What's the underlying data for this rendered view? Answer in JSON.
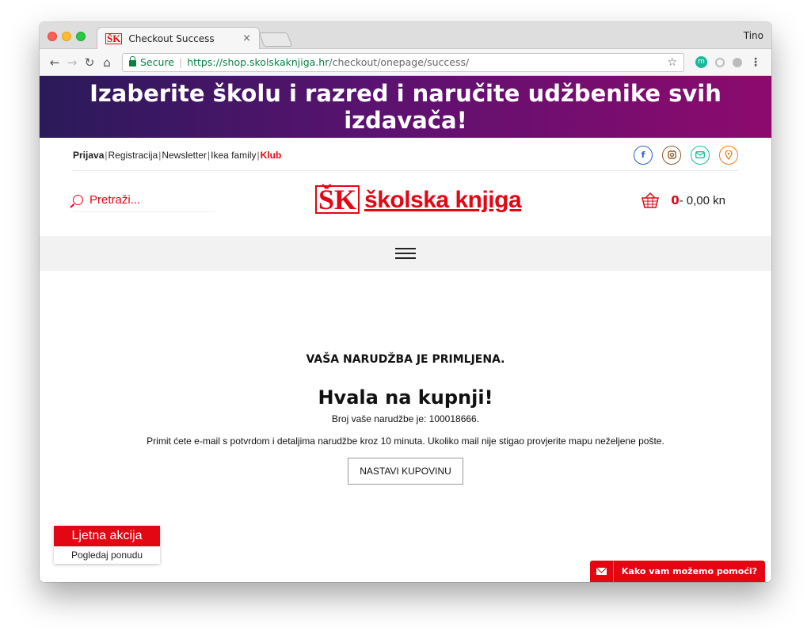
{
  "browser": {
    "tab_title": "Checkout Success",
    "tab_close": "×",
    "favicon_text": "ŠK",
    "profile_name": "Tino",
    "address": {
      "secure_label": "Secure",
      "separator": "|",
      "url_host": "https://shop.skolskaknjiga.hr",
      "url_path": "/checkout/onepage/success/"
    },
    "icons": [
      "back-arrow-icon",
      "forward-arrow-icon",
      "reload-icon",
      "home-icon",
      "lock-icon",
      "star-icon",
      "extension-icon",
      "menu-dots-icon"
    ]
  },
  "banner": {
    "line1": "Izaberite školu i razred i naručite udžbenike svih",
    "line2": "izdavača!"
  },
  "topbar": {
    "links": {
      "login": "Prijava",
      "register": "Registracija",
      "newsletter": "Newsletter",
      "ikea": "Ikea family",
      "klub": "Klub"
    },
    "socials": [
      "facebook-icon",
      "instagram-icon",
      "mail-icon",
      "location-icon"
    ]
  },
  "header": {
    "search_placeholder": "Pretraži...",
    "logo_mark": "ŠK",
    "logo_text": "školska knjiga",
    "cart_count": "0",
    "cart_total": "- 0,00 kn"
  },
  "content": {
    "heading": "VAŠA NARUDŽBA JE PRIMLJENA.",
    "thanks": "Hvala na kupnji!",
    "order_number": "Broj vaše narudžbe je: 100018666.",
    "info": "Primit ćete e-mail s potvrdom i detaljima narudžbe kroz 10 minuta. Ukoliko mail nije stigao provjerite mapu neželjene pošte.",
    "continue_button": "NASTAVI KUPOVINU"
  },
  "promo": {
    "title": "Ljetna akcija",
    "link": "Pogledaj ponudu"
  },
  "help": {
    "label": "Kako vam možemo pomoći?"
  },
  "colors": {
    "brand_red": "#e30613",
    "banner_start": "#2a1a5a",
    "banner_end": "#8d0a6e",
    "secure_green": "#0b8043"
  }
}
